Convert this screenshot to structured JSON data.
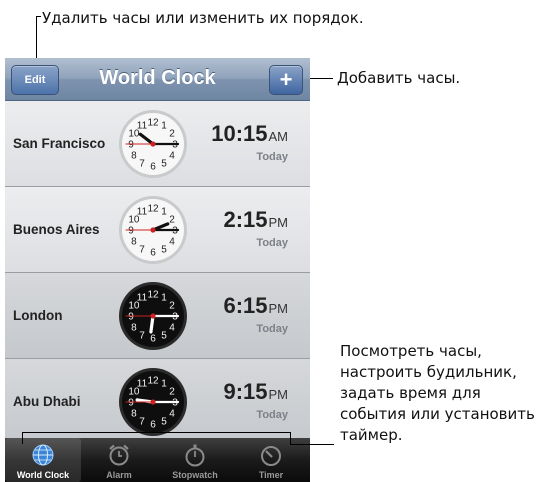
{
  "callouts": {
    "edit_note": "Удалить часы или изменить их порядок.",
    "add_note": "Добавить часы.",
    "tabs_note_lines": [
      "Посмотреть часы,",
      "настроить будильник,",
      "задать время для",
      "события или установить",
      "таймер."
    ]
  },
  "navbar": {
    "title": "World Clock",
    "edit_label": "Edit",
    "add_label": "+"
  },
  "clocks": [
    {
      "city": "San Francisco",
      "time": "10:15",
      "ampm": "AM",
      "day": "Today",
      "face": "day"
    },
    {
      "city": "Buenos Aires",
      "time": "2:15",
      "ampm": "PM",
      "day": "Today",
      "face": "day"
    },
    {
      "city": "London",
      "time": "6:15",
      "ampm": "PM",
      "day": "Today",
      "face": "night"
    },
    {
      "city": "Abu Dhabi",
      "time": "9:15",
      "ampm": "PM",
      "day": "Today",
      "face": "night"
    }
  ],
  "tabs": [
    {
      "label": "World Clock",
      "icon": "globe-icon",
      "active": true
    },
    {
      "label": "Alarm",
      "icon": "alarm-clock-icon",
      "active": false
    },
    {
      "label": "Stopwatch",
      "icon": "stopwatch-icon",
      "active": false
    },
    {
      "label": "Timer",
      "icon": "timer-icon",
      "active": false
    }
  ]
}
